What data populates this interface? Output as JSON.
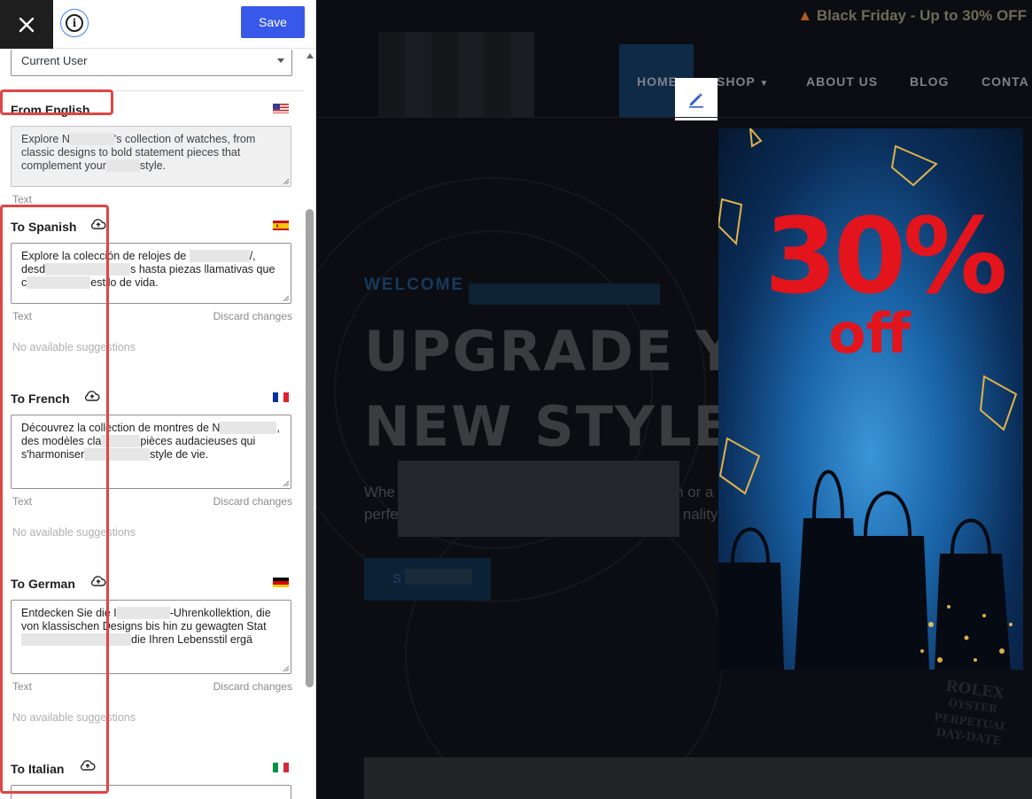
{
  "toolbar": {
    "close_icon": "close-icon",
    "info_icon": "info-icon",
    "info_glyph": "i",
    "save_label": "Save"
  },
  "scope_select": {
    "value": "Current User"
  },
  "source": {
    "title": "From English",
    "flag": "us-flag-icon",
    "text_a": "Explore N",
    "text_b": "'s collection of watches, from classic designs to bold statement pieces that complement your",
    "text_c": "style.",
    "type_label": "Text"
  },
  "translations": [
    {
      "title": "To Spanish",
      "flag": "spain-flag-icon",
      "text_a": "Explore la colección de relojes de",
      "text_b": "/, desd",
      "text_c": "s hasta piezas llamativas que c",
      "text_d": "estilo de vida.",
      "type_label": "Text",
      "discard_label": "Discard changes",
      "suggestions": "No available suggestions"
    },
    {
      "title": "To French",
      "flag": "france-flag-icon",
      "text_a": "Découvrez la collection de montres de N",
      "text_b": ", des modèles cla",
      "text_c": "pièces audacieuses qui s'harmoniser",
      "text_d": "style de vie.",
      "type_label": "Text",
      "discard_label": "Discard changes",
      "suggestions": "No available suggestions"
    },
    {
      "title": "To German",
      "flag": "germany-flag-icon",
      "text_a": "Entdecken Sie die I",
      "text_b": "-Uhrenkollektion, die von klassischen Designs bis hin zu gewagten Stat",
      "text_c": "die Ihren Lebensstil ergä",
      "text_d": "",
      "type_label": "Text",
      "discard_label": "Discard changes",
      "suggestions": "No available suggestions"
    },
    {
      "title": "To Italian",
      "flag": "italy-flag-icon"
    }
  ],
  "preview": {
    "promo": "Black Friday - Up to 30% OFF",
    "promo_icon": "fire-icon",
    "nav": [
      "HOME",
      "SHOP",
      "ABOUT US",
      "BLOG",
      "CONTA"
    ],
    "edit_icon": "pencil-icon",
    "welcome": "WELCOME",
    "hero_title_1": "UPGRADE YO",
    "hero_title_2": "NEW STYLE",
    "hero_sub_1": "Whe",
    "hero_sub_1b": "n or a",
    "hero_sub_2": "perfe",
    "hero_sub_2b": "nality",
    "cta_short": "S",
    "watch_text_1": "ROLEX",
    "watch_text_2": "OYSTER PERPETUAL",
    "watch_text_3": "DAY-DATE",
    "sale_percent": "30%",
    "sale_off": "off"
  },
  "colors": {
    "accent": "#3858e9",
    "highlight": "#e04545",
    "sale_red": "#e3141c"
  }
}
